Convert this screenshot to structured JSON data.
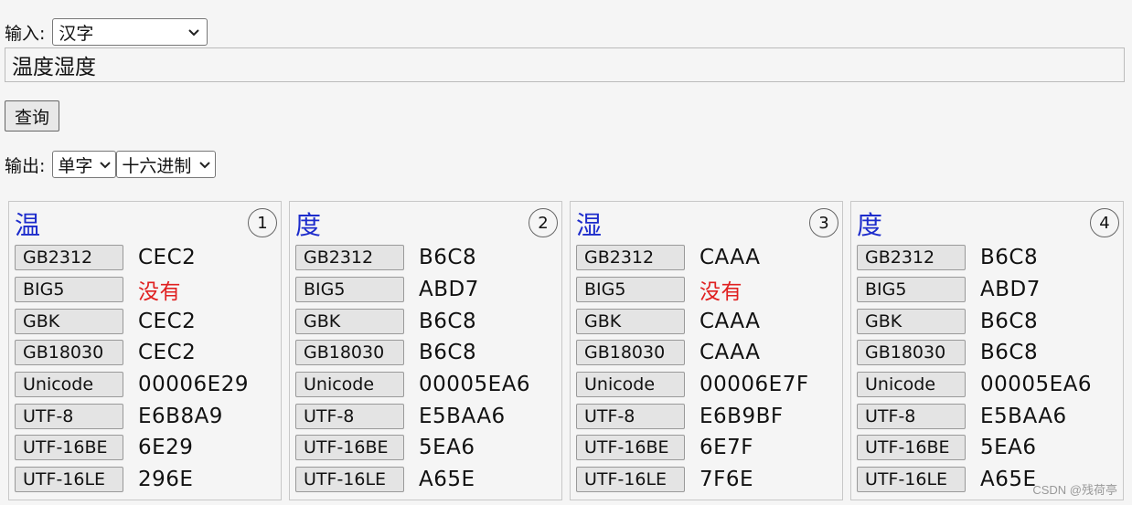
{
  "input_row": {
    "label": "输入:",
    "select_value": "汉字"
  },
  "text_input": {
    "value": "温度湿度"
  },
  "query_button": "查询",
  "output_row": {
    "label": "输出:",
    "mode_value": "单字",
    "format_value": "十六进制"
  },
  "cards": [
    {
      "char": "温",
      "index": "1",
      "rows": [
        {
          "label": "GB2312",
          "value": "CEC2",
          "missing": false
        },
        {
          "label": "BIG5",
          "value": "没有",
          "missing": true
        },
        {
          "label": "GBK",
          "value": "CEC2",
          "missing": false
        },
        {
          "label": "GB18030",
          "value": "CEC2",
          "missing": false
        },
        {
          "label": "Unicode",
          "value": "00006E29",
          "missing": false
        },
        {
          "label": "UTF-8",
          "value": "E6B8A9",
          "missing": false
        },
        {
          "label": "UTF-16BE",
          "value": "6E29",
          "missing": false
        },
        {
          "label": "UTF-16LE",
          "value": "296E",
          "missing": false
        }
      ]
    },
    {
      "char": "度",
      "index": "2",
      "rows": [
        {
          "label": "GB2312",
          "value": "B6C8",
          "missing": false
        },
        {
          "label": "BIG5",
          "value": "ABD7",
          "missing": false
        },
        {
          "label": "GBK",
          "value": "B6C8",
          "missing": false
        },
        {
          "label": "GB18030",
          "value": "B6C8",
          "missing": false
        },
        {
          "label": "Unicode",
          "value": "00005EA6",
          "missing": false
        },
        {
          "label": "UTF-8",
          "value": "E5BAA6",
          "missing": false
        },
        {
          "label": "UTF-16BE",
          "value": "5EA6",
          "missing": false
        },
        {
          "label": "UTF-16LE",
          "value": "A65E",
          "missing": false
        }
      ]
    },
    {
      "char": "湿",
      "index": "3",
      "rows": [
        {
          "label": "GB2312",
          "value": "CAAA",
          "missing": false
        },
        {
          "label": "BIG5",
          "value": "没有",
          "missing": true
        },
        {
          "label": "GBK",
          "value": "CAAA",
          "missing": false
        },
        {
          "label": "GB18030",
          "value": "CAAA",
          "missing": false
        },
        {
          "label": "Unicode",
          "value": "00006E7F",
          "missing": false
        },
        {
          "label": "UTF-8",
          "value": "E6B9BF",
          "missing": false
        },
        {
          "label": "UTF-16BE",
          "value": "6E7F",
          "missing": false
        },
        {
          "label": "UTF-16LE",
          "value": "7F6E",
          "missing": false
        }
      ]
    },
    {
      "char": "度",
      "index": "4",
      "rows": [
        {
          "label": "GB2312",
          "value": "B6C8",
          "missing": false
        },
        {
          "label": "BIG5",
          "value": "ABD7",
          "missing": false
        },
        {
          "label": "GBK",
          "value": "B6C8",
          "missing": false
        },
        {
          "label": "GB18030",
          "value": "B6C8",
          "missing": false
        },
        {
          "label": "Unicode",
          "value": "00005EA6",
          "missing": false
        },
        {
          "label": "UTF-8",
          "value": "E5BAA6",
          "missing": false
        },
        {
          "label": "UTF-16BE",
          "value": "5EA6",
          "missing": false
        },
        {
          "label": "UTF-16LE",
          "value": "A65E",
          "missing": false
        }
      ]
    }
  ],
  "watermark": "CSDN @残荷亭",
  "colors": {
    "char": "#1d2ccc",
    "missing": "#e02020",
    "background": "#f5f5f5"
  }
}
